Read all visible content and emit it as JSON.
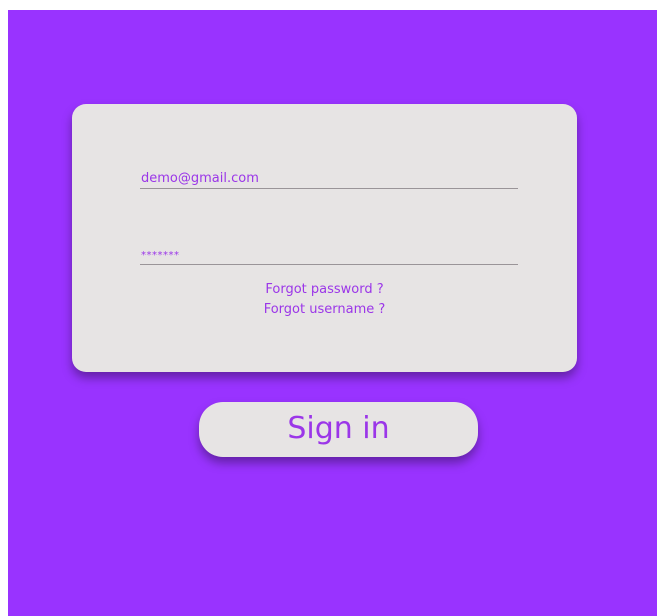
{
  "login": {
    "email_value": "demo@gmail.com",
    "password_value": "*******",
    "forgot_password_label": "Forgot password ?",
    "forgot_username_label": "Forgot username ?",
    "signin_label": "Sign in"
  },
  "colors": {
    "background": "#9933ff",
    "card": "#e7e4e4",
    "accent_text": "#9b36e8"
  }
}
